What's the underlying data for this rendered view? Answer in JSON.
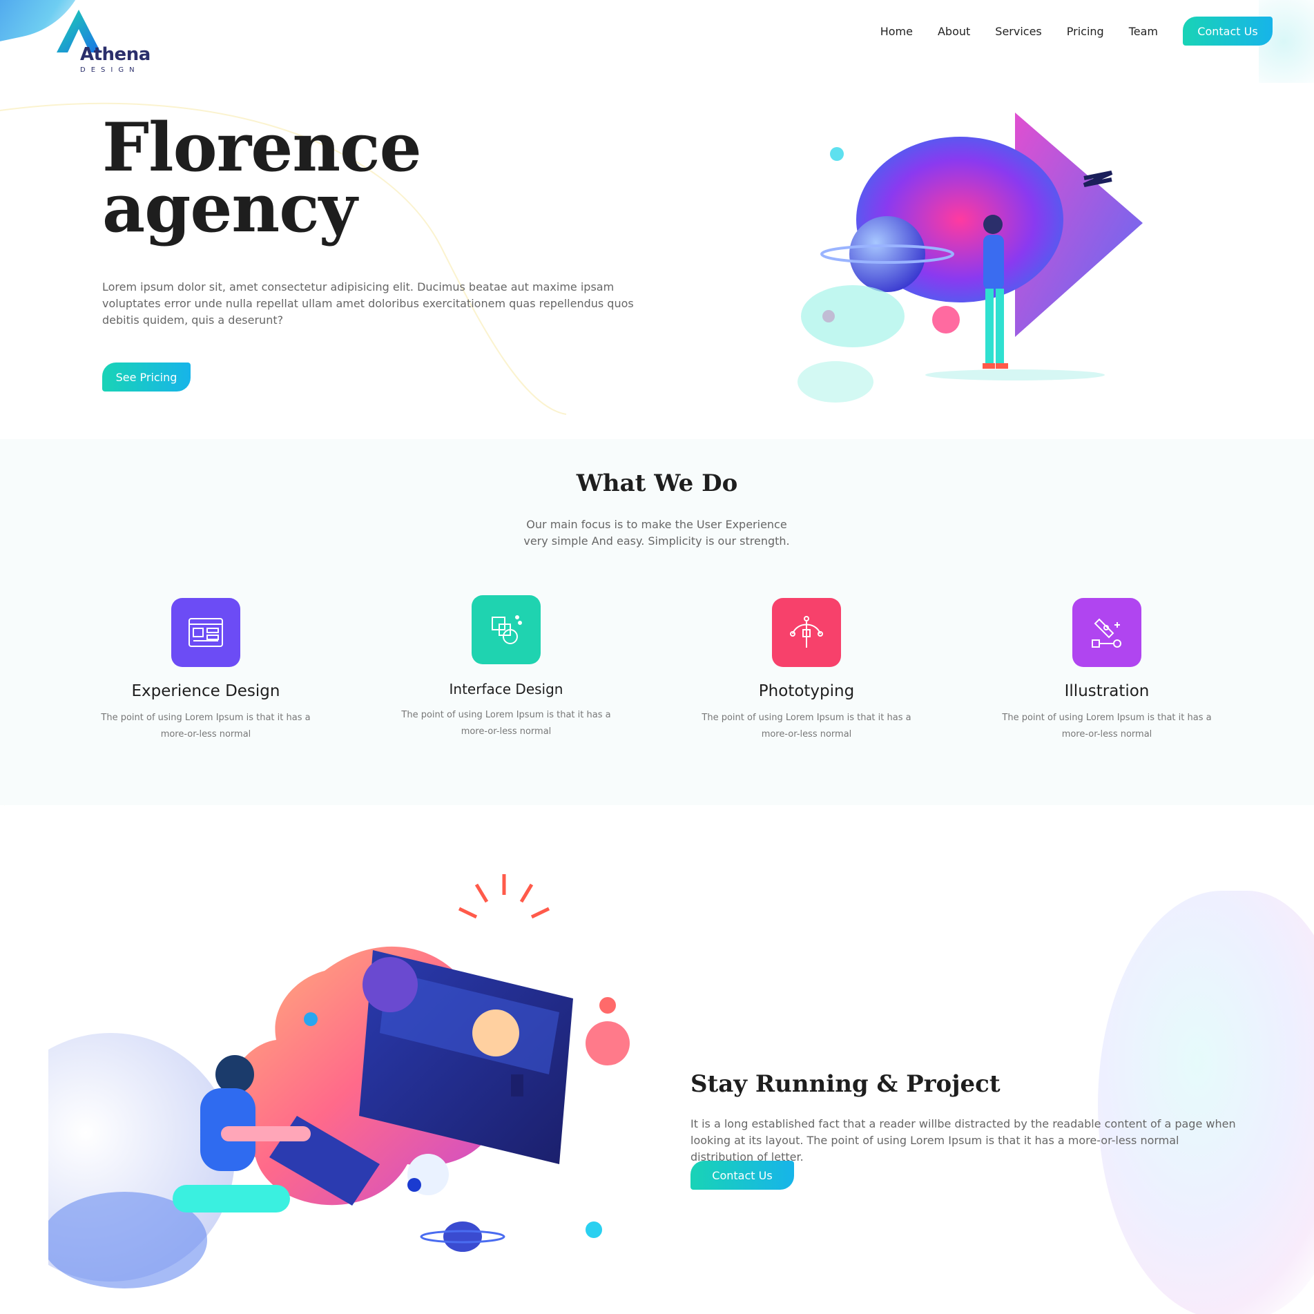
{
  "brand": {
    "name": "Athena",
    "tagline": "DESIGN",
    "color": "#2b2f6b",
    "accent": "#1fb8e6"
  },
  "nav": {
    "items": [
      {
        "label": "Home"
      },
      {
        "label": "About"
      },
      {
        "label": "Services"
      },
      {
        "label": "Pricing"
      },
      {
        "label": "Team"
      }
    ],
    "cta_label": "Contact Us"
  },
  "hero": {
    "title_line1": "Florence",
    "title_line2": "agency",
    "description": "Lorem ipsum dolor sit, amet consectetur adipisicing elit. Ducimus beatae aut maxime ipsam voluptates error unde nulla repellat ullam amet doloribus exercitationem quas repellendus quos debitis quidem, quis a deserunt?",
    "button_label": "See Pricing"
  },
  "services": {
    "title": "What We Do",
    "subtitle": "Our main focus is to make the User Experience very simple And easy. Simplicity is our strength.",
    "items": [
      {
        "title": "Experience Design",
        "desc": "The point of using Lorem Ipsum is that it has a more-or-less normal",
        "color": "#6c4cf5",
        "icon": "layout-icon"
      },
      {
        "title": "Interface Design",
        "desc": "The point of using Lorem Ipsum is that it has a more-or-less normal",
        "color": "#1fd3b0",
        "icon": "shapes-icon"
      },
      {
        "title": "Phototyping",
        "desc": "The point of using Lorem Ipsum is that it has a more-or-less normal",
        "color": "#f7416b",
        "icon": "bezier-icon"
      },
      {
        "title": "Illustration",
        "desc": "The point of using Lorem Ipsum is that it has a more-or-less normal",
        "color": "#b045f0",
        "icon": "pen-tool-icon"
      }
    ]
  },
  "project": {
    "title": "Stay Running & Project",
    "description": "It is a long established fact that a reader willbe distracted by the readable content of a page when looking at its layout. The point of using Lorem Ipsum is that it has a more-or-less normal distribution of letter.",
    "button_label": "Contact Us"
  }
}
